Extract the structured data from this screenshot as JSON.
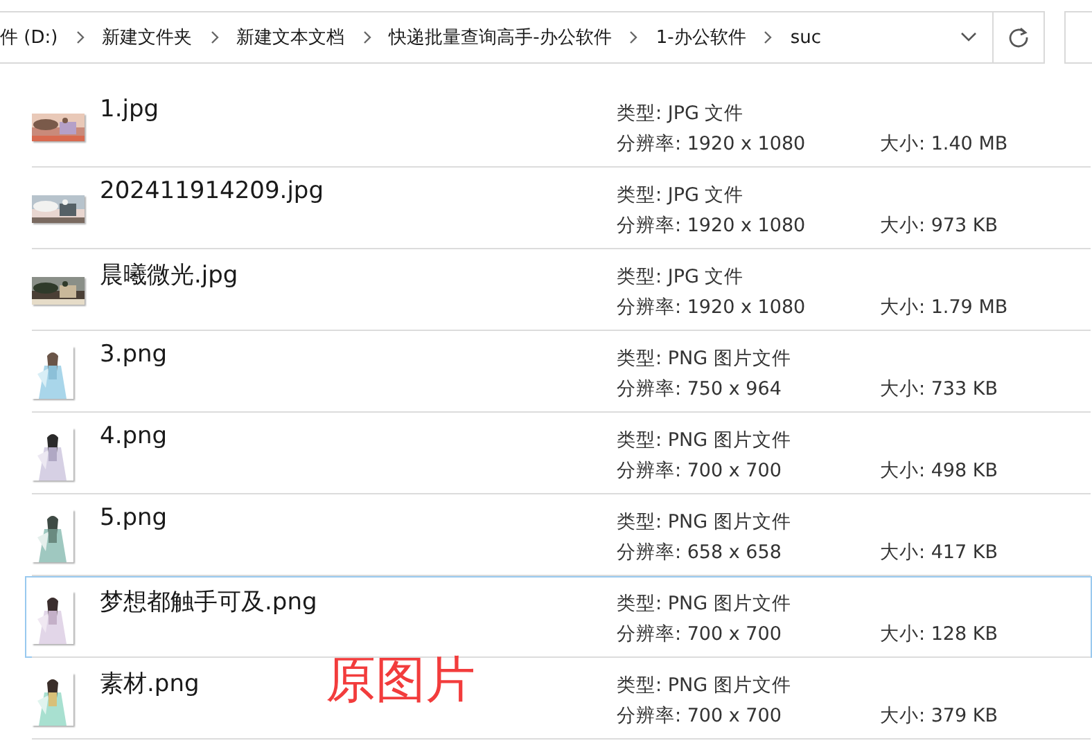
{
  "address_bar": {
    "crumbs": [
      "件 (D:)",
      "新建文件夹",
      "新建文本文档",
      "快递批量查询高手-办公软件",
      "1-办公软件",
      "suc"
    ]
  },
  "files": [
    {
      "name": "1.jpg",
      "kind": "wide",
      "type": "类型: JPG 文件",
      "resolution": "分辨率: 1920 x 1080",
      "size": "大小: 1.40 MB",
      "selected": false
    },
    {
      "name": "202411914209.jpg",
      "kind": "wide",
      "type": "类型: JPG 文件",
      "resolution": "分辨率: 1920 x 1080",
      "size": "大小: 973 KB",
      "selected": false
    },
    {
      "name": "晨曦微光.jpg",
      "kind": "wide",
      "type": "类型: JPG 文件",
      "resolution": "分辨率: 1920 x 1080",
      "size": "大小: 1.79 MB",
      "selected": false
    },
    {
      "name": "3.png",
      "kind": "tall",
      "type": "类型: PNG 图片文件",
      "resolution": "分辨率: 750 x 964",
      "size": "大小: 733 KB",
      "selected": false
    },
    {
      "name": "4.png",
      "kind": "tall",
      "type": "类型: PNG 图片文件",
      "resolution": "分辨率: 700 x 700",
      "size": "大小: 498 KB",
      "selected": false
    },
    {
      "name": "5.png",
      "kind": "tall",
      "type": "类型: PNG 图片文件",
      "resolution": "分辨率: 658 x 658",
      "size": "大小: 417 KB",
      "selected": false
    },
    {
      "name": "梦想都触手可及.png",
      "kind": "tall",
      "type": "类型: PNG 图片文件",
      "resolution": "分辨率: 700 x 700",
      "size": "大小: 128 KB",
      "selected": true
    },
    {
      "name": "素材.png",
      "kind": "tall",
      "type": "类型: PNG 图片文件",
      "resolution": "分辨率: 700 x 700",
      "size": "大小: 379 KB",
      "selected": false
    }
  ],
  "annotation": "原图片"
}
